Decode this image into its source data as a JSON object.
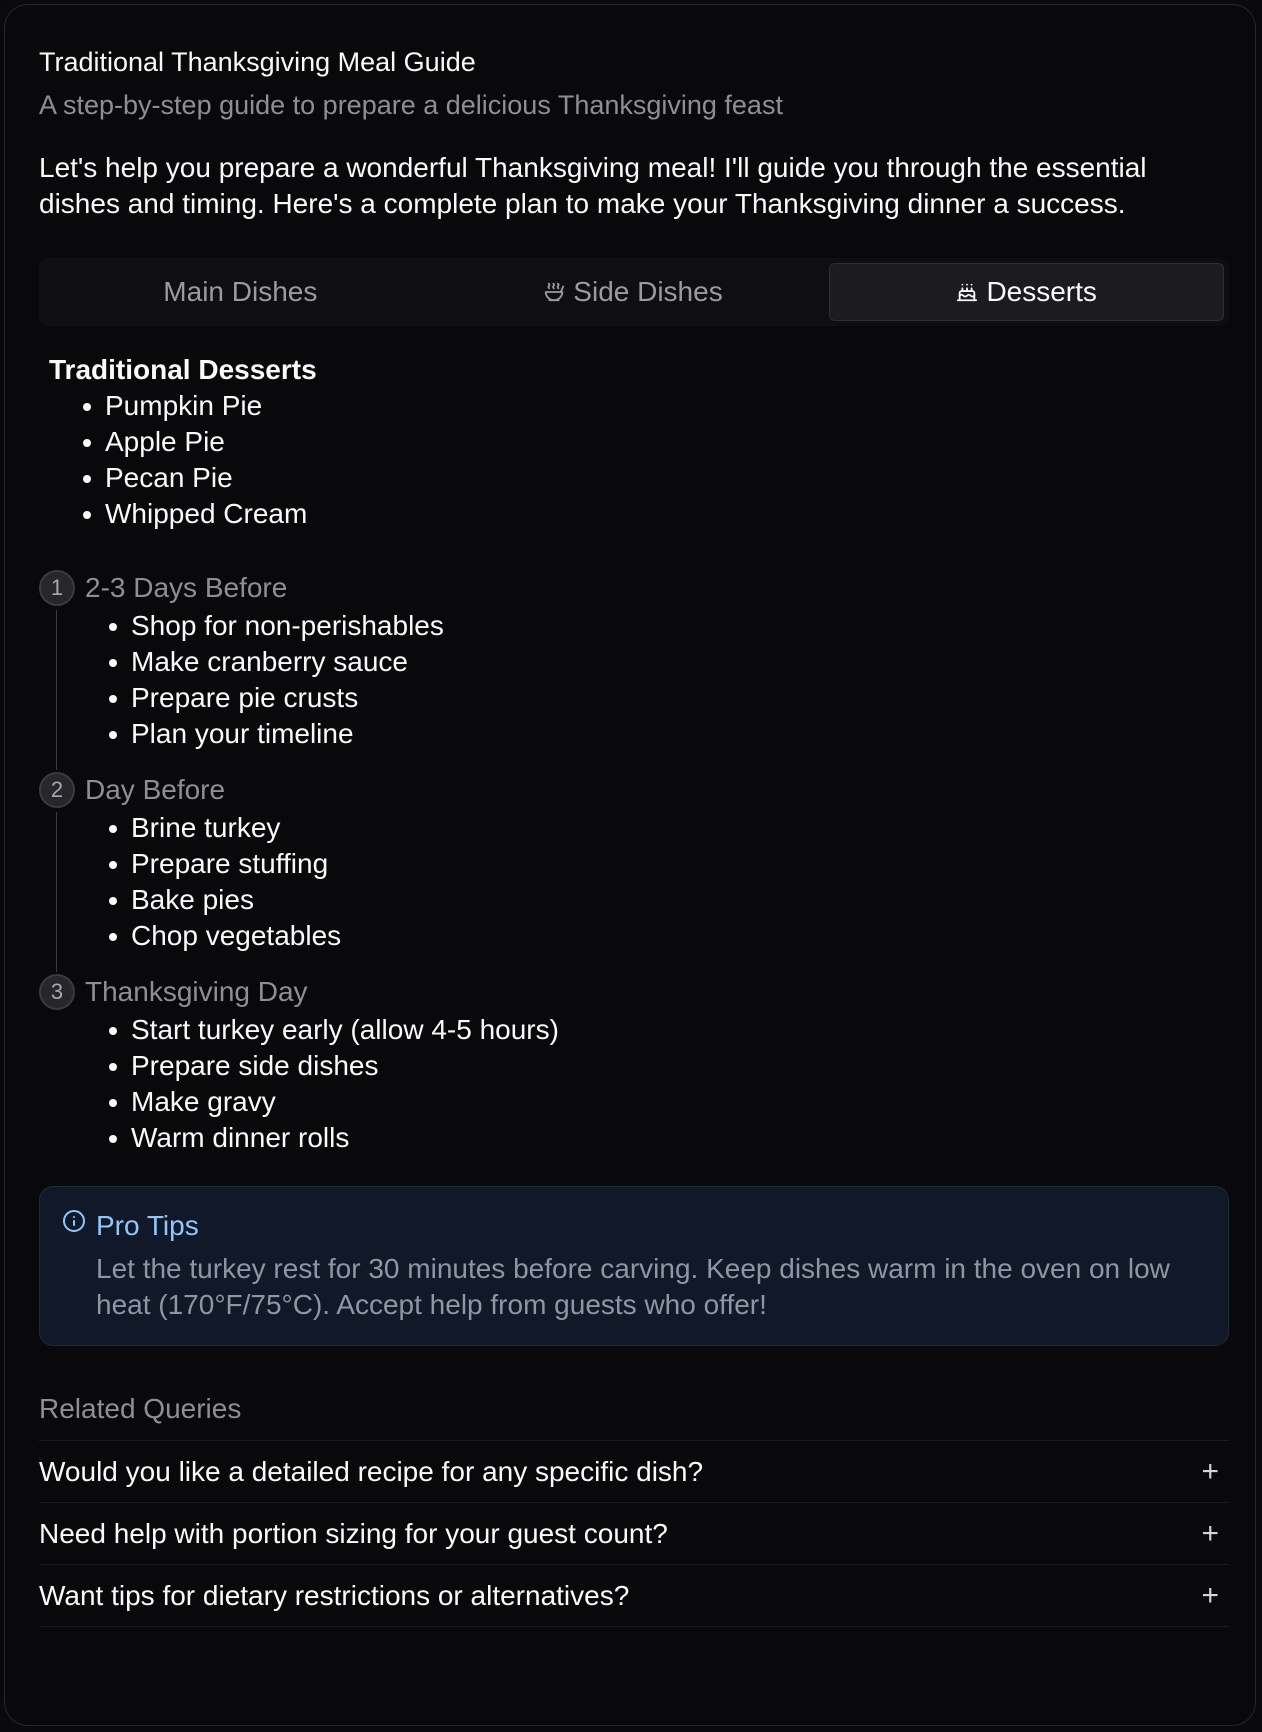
{
  "header": {
    "title": "Traditional Thanksgiving Meal Guide",
    "subtitle": "A step-by-step guide to prepare a delicious Thanksgiving feast"
  },
  "intro": "Let's help you prepare a wonderful Thanksgiving meal! I'll guide you through the essential dishes and timing. Here's a complete plan to make your Thanksgiving dinner a success.",
  "tabs": [
    {
      "label": "Main Dishes",
      "icon": "none",
      "active": false
    },
    {
      "label": "Side Dishes",
      "icon": "soup-bowl-icon",
      "active": false
    },
    {
      "label": "Desserts",
      "icon": "cake-icon",
      "active": true
    }
  ],
  "desserts": {
    "title": "Traditional Desserts",
    "items": [
      "Pumpkin Pie",
      "Apple Pie",
      "Pecan Pie",
      "Whipped Cream"
    ]
  },
  "timeline": [
    {
      "number": "1",
      "title": "2-3 Days Before",
      "items": [
        "Shop for non-perishables",
        "Make cranberry sauce",
        "Prepare pie crusts",
        "Plan your timeline"
      ]
    },
    {
      "number": "2",
      "title": "Day Before",
      "items": [
        "Brine turkey",
        "Prepare stuffing",
        "Bake pies",
        "Chop vegetables"
      ]
    },
    {
      "number": "3",
      "title": "Thanksgiving Day",
      "items": [
        "Start turkey early (allow 4-5 hours)",
        "Prepare side dishes",
        "Make gravy",
        "Warm dinner rolls"
      ]
    }
  ],
  "tips": {
    "title": "Pro Tips",
    "body": "Let the turkey rest for 30 minutes before carving. Keep dishes warm in the oven on low heat (170°F/75°C). Accept help from guests who offer!"
  },
  "related": {
    "title": "Related Queries",
    "queries": [
      "Would you like a detailed recipe for any specific dish?",
      "Need help with portion sizing for your guest count?",
      "Want tips for dietary restrictions or alternatives?"
    ],
    "expand_symbol": "+"
  }
}
